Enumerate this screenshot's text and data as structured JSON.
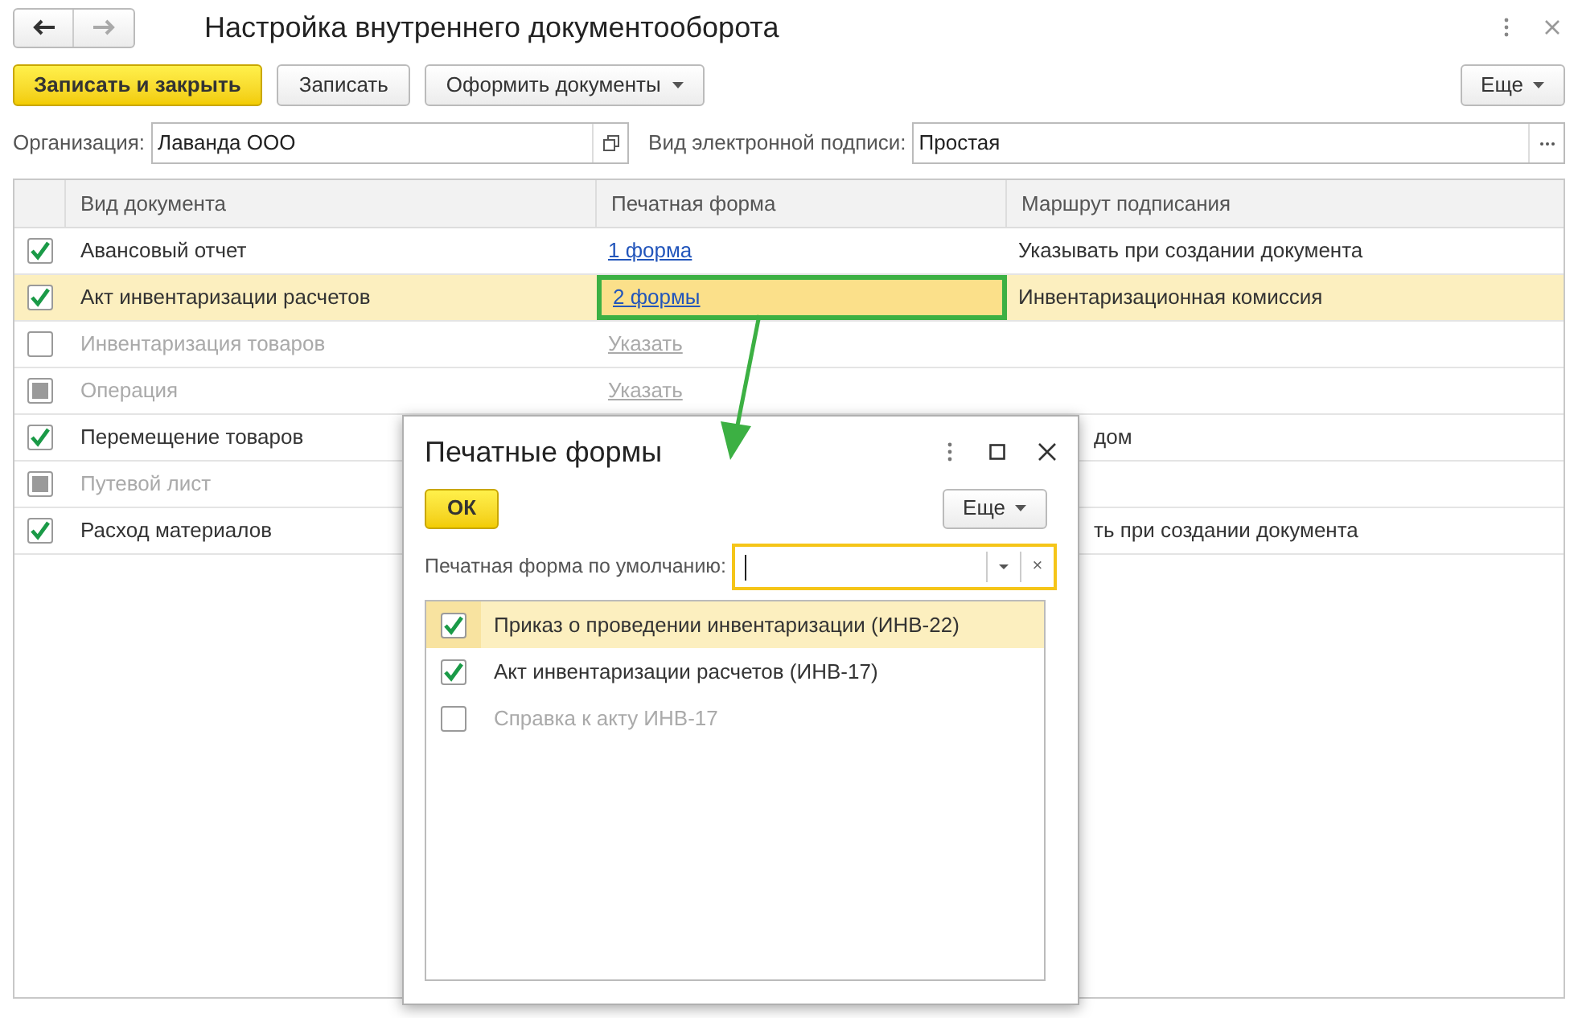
{
  "window": {
    "title": "Настройка внутреннего документооборота"
  },
  "toolbar": {
    "buttons": [
      {
        "label": "Записать и закрыть",
        "kind": "primary"
      },
      {
        "label": "Записать",
        "kind": "plain"
      },
      {
        "label": "Оформить документы",
        "kind": "dropdown"
      }
    ],
    "more": "Еще"
  },
  "fields": [
    {
      "label": "Организация:",
      "value": "Лаванда ООО",
      "kind": "open"
    },
    {
      "label": "Вид электронной подписи:",
      "value": "Простая",
      "kind": "choice"
    }
  ],
  "table": {
    "columns": [
      "Вид документа",
      "Печатная форма",
      "Маршрут подписания"
    ],
    "rows": [
      {
        "checked": true,
        "partial": false,
        "disabled": false,
        "selected": false,
        "highlighted": false,
        "name": "Авансовый отчет",
        "form": "1 форма",
        "route": "Указывать при создании документа"
      },
      {
        "checked": true,
        "partial": false,
        "disabled": false,
        "selected": true,
        "highlighted": true,
        "name": "Акт инвентаризации расчетов",
        "form": "2 формы",
        "route": "Инвентаризационная комиссия"
      },
      {
        "checked": false,
        "partial": false,
        "disabled": true,
        "selected": false,
        "highlighted": false,
        "name": "Инвентаризация товаров",
        "form": "Указать"
      },
      {
        "checked": false,
        "partial": true,
        "disabled": true,
        "selected": false,
        "highlighted": false,
        "name": "Операция",
        "form": "Указать"
      },
      {
        "checked": true,
        "partial": false,
        "disabled": false,
        "selected": false,
        "name": "Перемещение товаров",
        "route": "дом"
      },
      {
        "checked": false,
        "partial": true,
        "disabled": true,
        "selected": false,
        "name": "Путевой лист"
      },
      {
        "checked": true,
        "partial": false,
        "disabled": false,
        "selected": false,
        "name": "Расход материалов",
        "route": "ть при создании документа"
      }
    ]
  },
  "dialog": {
    "title": "Печатные формы",
    "ok": "ОК",
    "more": "Еще",
    "default_label": "Печатная форма по умолчанию:",
    "clear": "×",
    "items": [
      {
        "label": "Приказ о проведении инвентаризации (ИНВ-22)",
        "checked": true,
        "disabled": false,
        "selected": true
      },
      {
        "label": "Акт инвентаризации расчетов (ИНВ-17)",
        "checked": true,
        "disabled": false,
        "selected": false
      },
      {
        "label": "Справка к акту ИНВ-17",
        "checked": false,
        "disabled": true,
        "selected": false
      }
    ]
  }
}
